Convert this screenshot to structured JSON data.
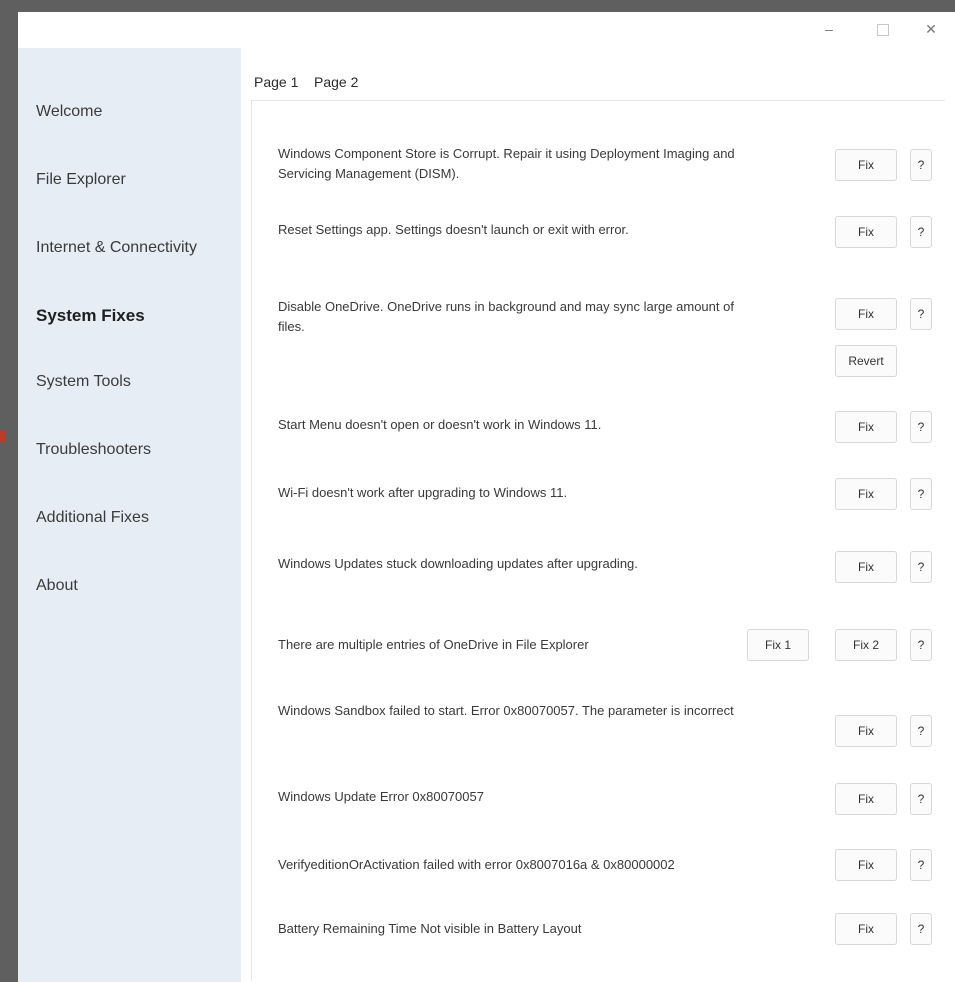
{
  "window_controls": {
    "minimize": "–",
    "close": "✕"
  },
  "sidebar": {
    "items": [
      {
        "label": "Welcome"
      },
      {
        "label": "File Explorer"
      },
      {
        "label": "Internet & Connectivity"
      },
      {
        "label": "System Fixes",
        "selected": true
      },
      {
        "label": "System Tools"
      },
      {
        "label": "Troubleshooters"
      },
      {
        "label": "Additional Fixes"
      },
      {
        "label": "About"
      }
    ]
  },
  "tabs": [
    {
      "label": "Page 1",
      "selected": true
    },
    {
      "label": "Page 2"
    }
  ],
  "fixes": [
    {
      "text": "Windows Component Store is Corrupt. Repair it using Deployment Imaging and Servicing Management (DISM).",
      "fix": "Fix",
      "help": "?"
    },
    {
      "text": "Reset Settings app. Settings doesn't launch or exit with error.",
      "fix": "Fix",
      "help": "?"
    },
    {
      "text": "Disable OneDrive. OneDrive runs in background and may sync large amount of files.",
      "fix": "Fix",
      "revert": "Revert",
      "help": "?"
    },
    {
      "text": "Start Menu doesn't open or doesn't work in Windows 11.",
      "fix": "Fix",
      "help": "?"
    },
    {
      "text": "Wi-Fi doesn't work after upgrading to Windows 11.",
      "fix": "Fix",
      "help": "?"
    },
    {
      "text": "Windows Updates stuck downloading updates after upgrading.",
      "fix": "Fix",
      "help": "?"
    },
    {
      "text": "There are multiple entries of OneDrive in File Explorer",
      "fix1": "Fix 1",
      "fix2": "Fix 2",
      "help": "?"
    },
    {
      "text": "Windows Sandbox failed to start. Error 0x80070057. The parameter is incorrect",
      "fix": "Fix",
      "help": "?"
    },
    {
      "text": "Windows Update Error 0x80070057",
      "fix": "Fix",
      "help": "?"
    },
    {
      "text": "VerifyeditionOrActivation failed with error 0x8007016a & 0x80000002",
      "fix": "Fix",
      "help": "?"
    },
    {
      "text": "Battery Remaining Time Not visible in Battery Layout",
      "fix": "Fix",
      "help": "?"
    }
  ]
}
